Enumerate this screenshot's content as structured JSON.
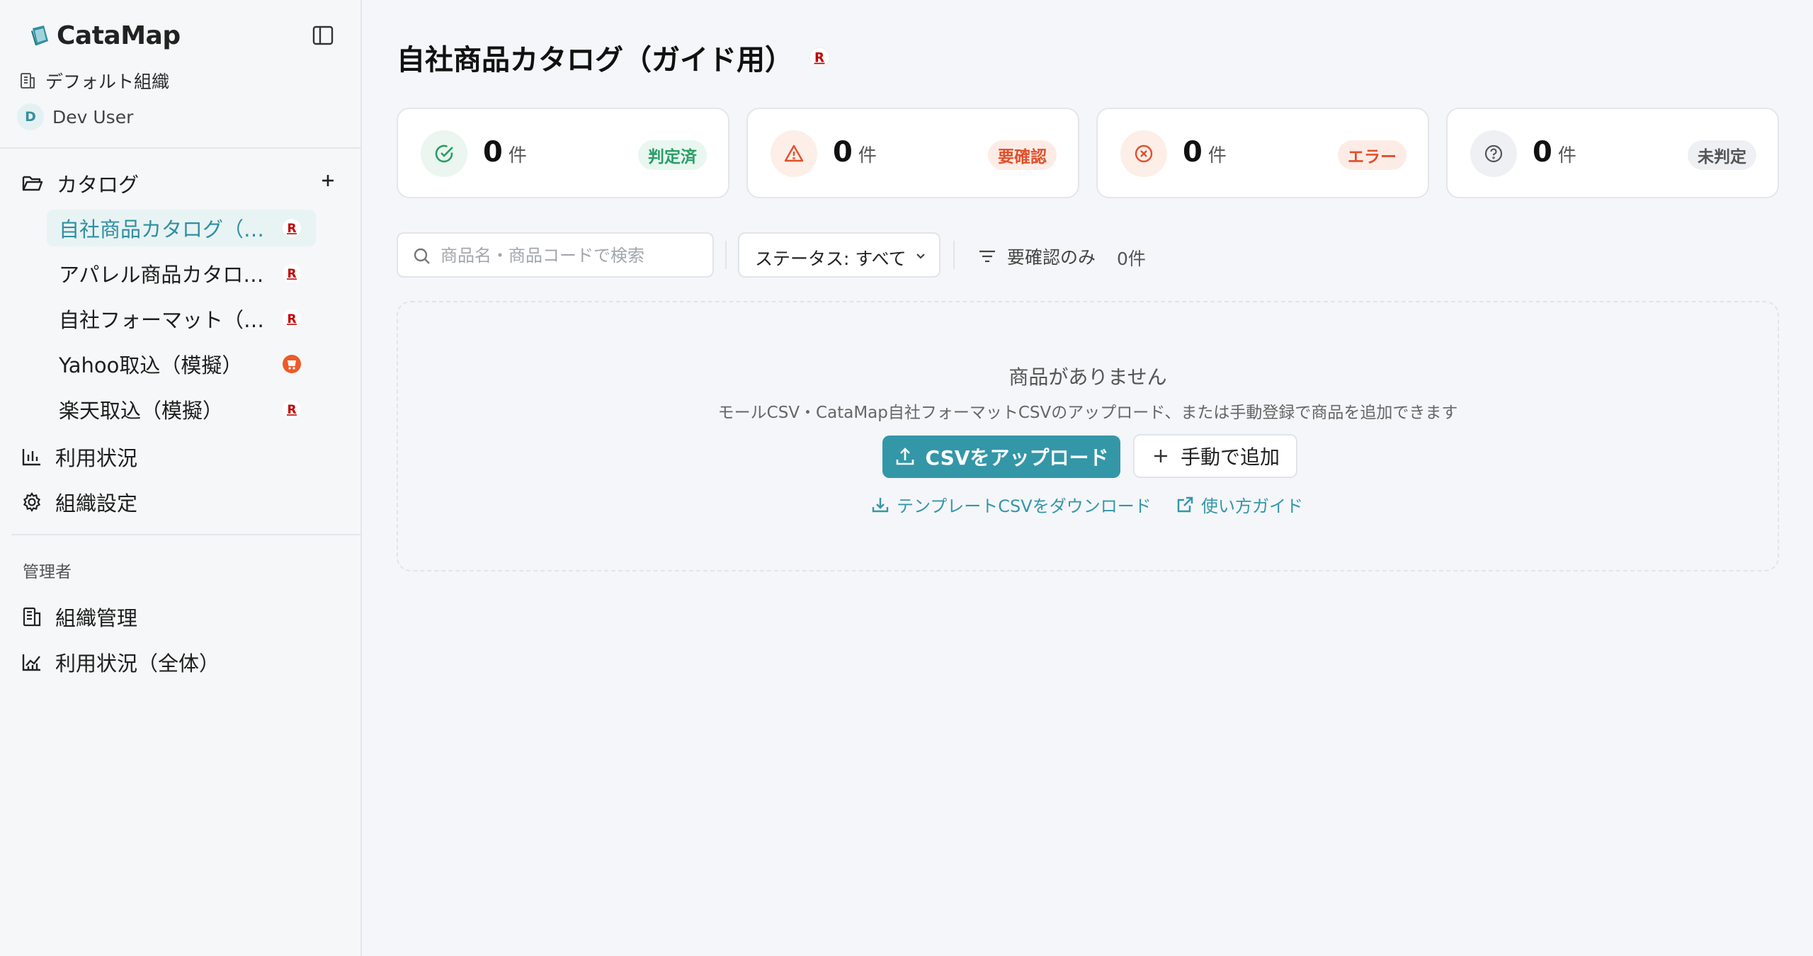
{
  "app": {
    "name": "CataMap"
  },
  "sidebar": {
    "org_name": "デフォルト組織",
    "user": {
      "initial": "D",
      "name": "Dev User"
    },
    "catalog_section_label": "カタログ",
    "catalogs": [
      {
        "label": "自社商品カタログ（…",
        "badge": "rakuten",
        "active": true
      },
      {
        "label": "アパレル商品カタロ…",
        "badge": "rakuten",
        "active": false
      },
      {
        "label": "自社フォーマット（…",
        "badge": "rakuten",
        "active": false
      },
      {
        "label": "Yahoo取込（模擬）",
        "badge": "yahoo-shopping",
        "active": false
      },
      {
        "label": "楽天取込（模擬）",
        "badge": "rakuten",
        "active": false
      }
    ],
    "nav": {
      "usage": "利用状況",
      "org_settings": "組織設定"
    },
    "admin_section_label": "管理者",
    "admin_nav": {
      "org_management": "組織管理",
      "usage_all": "利用状況（全体）"
    }
  },
  "main": {
    "title": "自社商品カタログ（ガイド用）",
    "title_badge": "rakuten",
    "stats": [
      {
        "icon": "check-circle-icon",
        "value": "0",
        "unit": "件",
        "tag": "判定済",
        "color": "#2a9d67",
        "bg": "#e8f7ef"
      },
      {
        "icon": "warning-triangle-icon",
        "value": "0",
        "unit": "件",
        "tag": "要確認",
        "color": "#e0502b",
        "bg": "#fdece6"
      },
      {
        "icon": "x-circle-icon",
        "value": "0",
        "unit": "件",
        "tag": "エラー",
        "color": "#e0502b",
        "bg": "#fdece6"
      },
      {
        "icon": "question-circle-icon",
        "value": "0",
        "unit": "件",
        "tag": "未判定",
        "color": "#555555",
        "bg": "#eef0f3"
      }
    ],
    "toolbar": {
      "search_placeholder": "商品名・商品コードで検索",
      "status_filter": "ステータス: すべて",
      "needs_review_only": "要確認のみ",
      "count": "0件"
    },
    "empty": {
      "title": "商品がありません",
      "description": "モールCSV・CataMap自社フォーマットCSVのアップロード、または手動登録で商品を追加できます",
      "upload_button": "CSVをアップロード",
      "manual_add_button": "手動で追加",
      "template_link": "テンプレートCSVをダウンロード",
      "guide_link": "使い方ガイド"
    }
  },
  "colors": {
    "accent": "#3397a8",
    "rakuten": "#bf0000",
    "yahoo": "#ef5a28"
  }
}
